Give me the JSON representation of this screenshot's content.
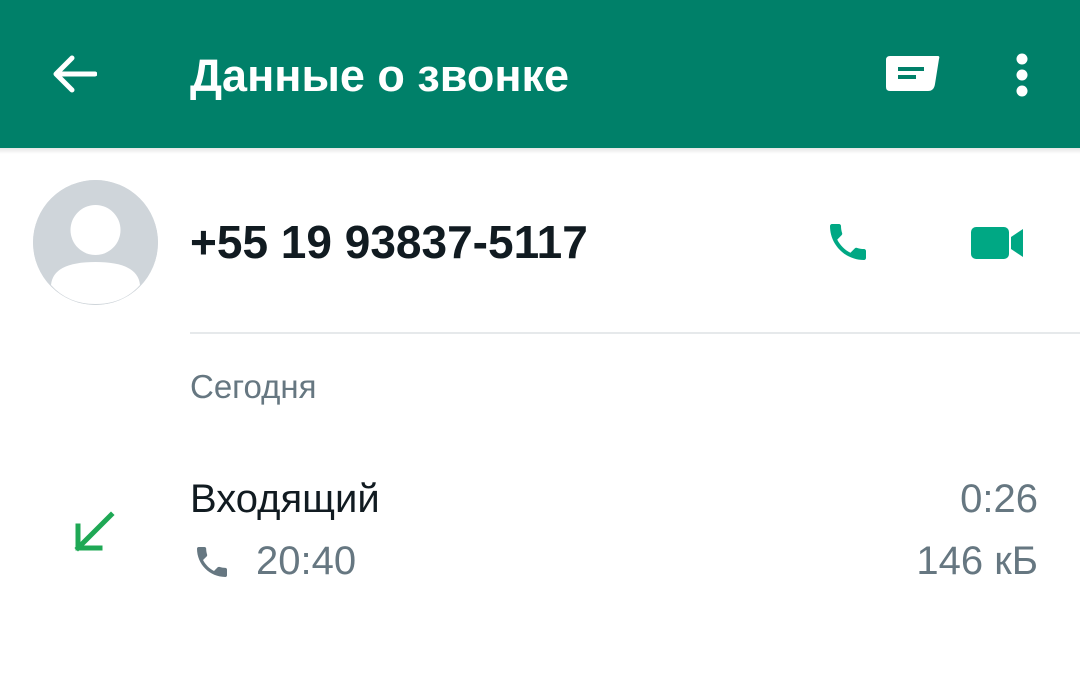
{
  "colors": {
    "app_bar": "#008069",
    "accent_green": "#00a884",
    "incoming_arrow": "#1fa855",
    "primary_text": "#111b21",
    "secondary_text": "#667781",
    "avatar_bg": "#cfd5da"
  },
  "header": {
    "title": "Данные о звонке",
    "back_icon": "arrow-left-icon",
    "message_icon": "message-icon",
    "menu_icon": "more-vert-icon"
  },
  "contact": {
    "phone_number": "+55 19 93837-5117",
    "avatar_icon": "default-avatar-icon",
    "voice_call_icon": "phone-icon",
    "video_call_icon": "videocam-icon"
  },
  "section": {
    "label": "Сегодня"
  },
  "calls": [
    {
      "type": "Входящий",
      "direction_icon": "incoming-arrow-icon",
      "call_icon": "phone-icon",
      "time": "20:40",
      "duration": "0:26",
      "size": "146 кБ"
    }
  ]
}
